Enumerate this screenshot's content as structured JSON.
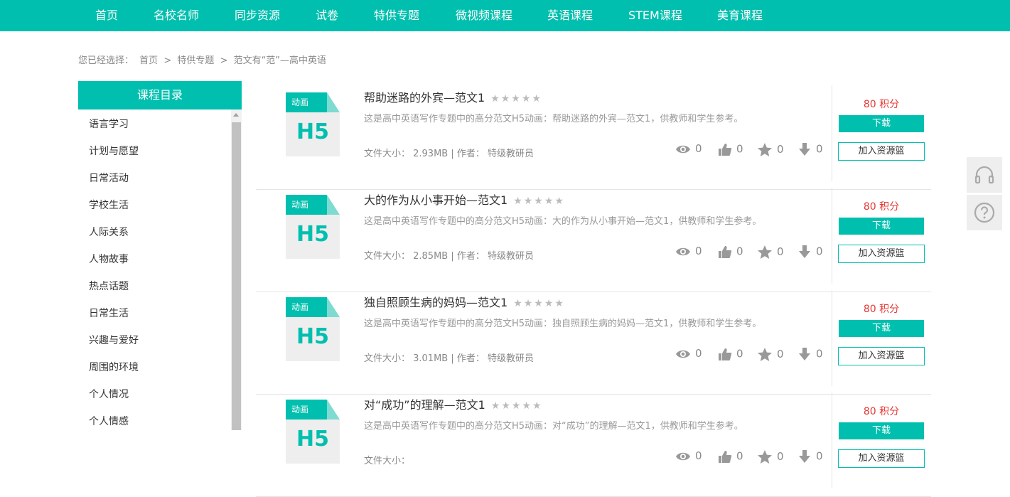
{
  "nav": {
    "items": [
      "首页",
      "名校名师",
      "同步资源",
      "试卷",
      "特供专题",
      "微视频课程",
      "英语课程",
      "STEM课程",
      "美育课程"
    ]
  },
  "breadcrumb": {
    "prefix": "您已经选择：",
    "items": [
      "首页",
      ">",
      "特供专题",
      ">",
      "范文有“范”—高中英语"
    ]
  },
  "sidebar": {
    "title": "课程目录",
    "items": [
      "语言学习",
      "计划与愿望",
      "日常活动",
      "学校生活",
      "人际关系",
      "人物故事",
      "热点话题",
      "日常生活",
      "兴趣与爱好",
      "周围的环境",
      "个人情况",
      "个人情感"
    ]
  },
  "thumbnail": {
    "tag": "动画",
    "text": "H5"
  },
  "stars": "★★★★★",
  "labels": {
    "download": "下载",
    "basket": "加入资源篮"
  },
  "colors": {
    "accent": "#00bfae",
    "points": "#e53935"
  },
  "resources": [
    {
      "title": "帮助迷路的外宾—范文1",
      "desc": "这是高中英语写作专题中的高分范文H5动画：帮助迷路的外宾—范文1，供教师和学生参考。",
      "meta": "文件大小： 2.93MB | 作者： 特级教研员",
      "views": "0",
      "likes": "0",
      "favs": "0",
      "downloads": "0",
      "points": "80 积分"
    },
    {
      "title": "大的作为从小事开始—范文1",
      "desc": "这是高中英语写作专题中的高分范文H5动画：大的作为从小事开始—范文1，供教师和学生参考。",
      "meta": "文件大小： 2.85MB | 作者： 特级教研员",
      "views": "0",
      "likes": "0",
      "favs": "0",
      "downloads": "0",
      "points": "80 积分"
    },
    {
      "title": "独自照顾生病的妈妈—范文1",
      "desc": "这是高中英语写作专题中的高分范文H5动画：独自照顾生病的妈妈—范文1，供教师和学生参考。",
      "meta": "文件大小： 3.01MB | 作者： 特级教研员",
      "views": "0",
      "likes": "0",
      "favs": "0",
      "downloads": "0",
      "points": "80 积分"
    },
    {
      "title": "对“成功”的理解—范文1",
      "desc": "这是高中英语写作专题中的高分范文H5动画：对“成功”的理解—范文1，供教师和学生参考。",
      "meta": "文件大小：",
      "views": "0",
      "likes": "0",
      "favs": "0",
      "downloads": "0",
      "points": "80 积分"
    }
  ]
}
